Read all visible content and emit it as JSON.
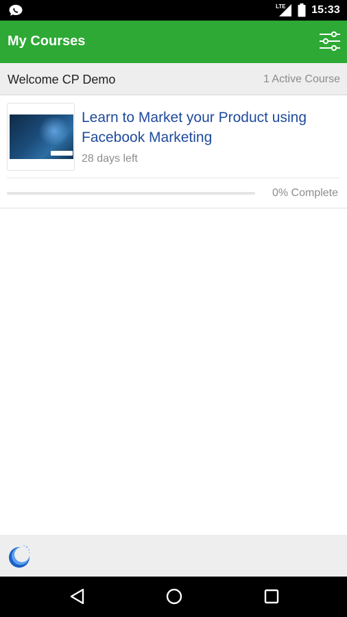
{
  "status_bar": {
    "network": "LTE",
    "time": "15:33",
    "icons": [
      "whatsapp-icon",
      "signal-icon",
      "battery-icon"
    ]
  },
  "app_bar": {
    "title": "My Courses",
    "filter_icon": "sliders-icon",
    "background": "#2ea935"
  },
  "welcome": {
    "greeting": "Welcome CP Demo",
    "active_count": "1 Active Course"
  },
  "courses": [
    {
      "title": "Learn to Market your Product using Facebook Marketing",
      "days_left": "28 days left",
      "progress": 0,
      "progress_label": "0% Complete",
      "thumbnail_icon": "course-thumbnail",
      "title_color": "#1f4a9c"
    }
  ],
  "footer": {
    "logo_icon": "brand-logo-icon"
  },
  "nav_bar": {
    "icons": [
      "back-icon",
      "home-icon",
      "recents-icon"
    ]
  }
}
